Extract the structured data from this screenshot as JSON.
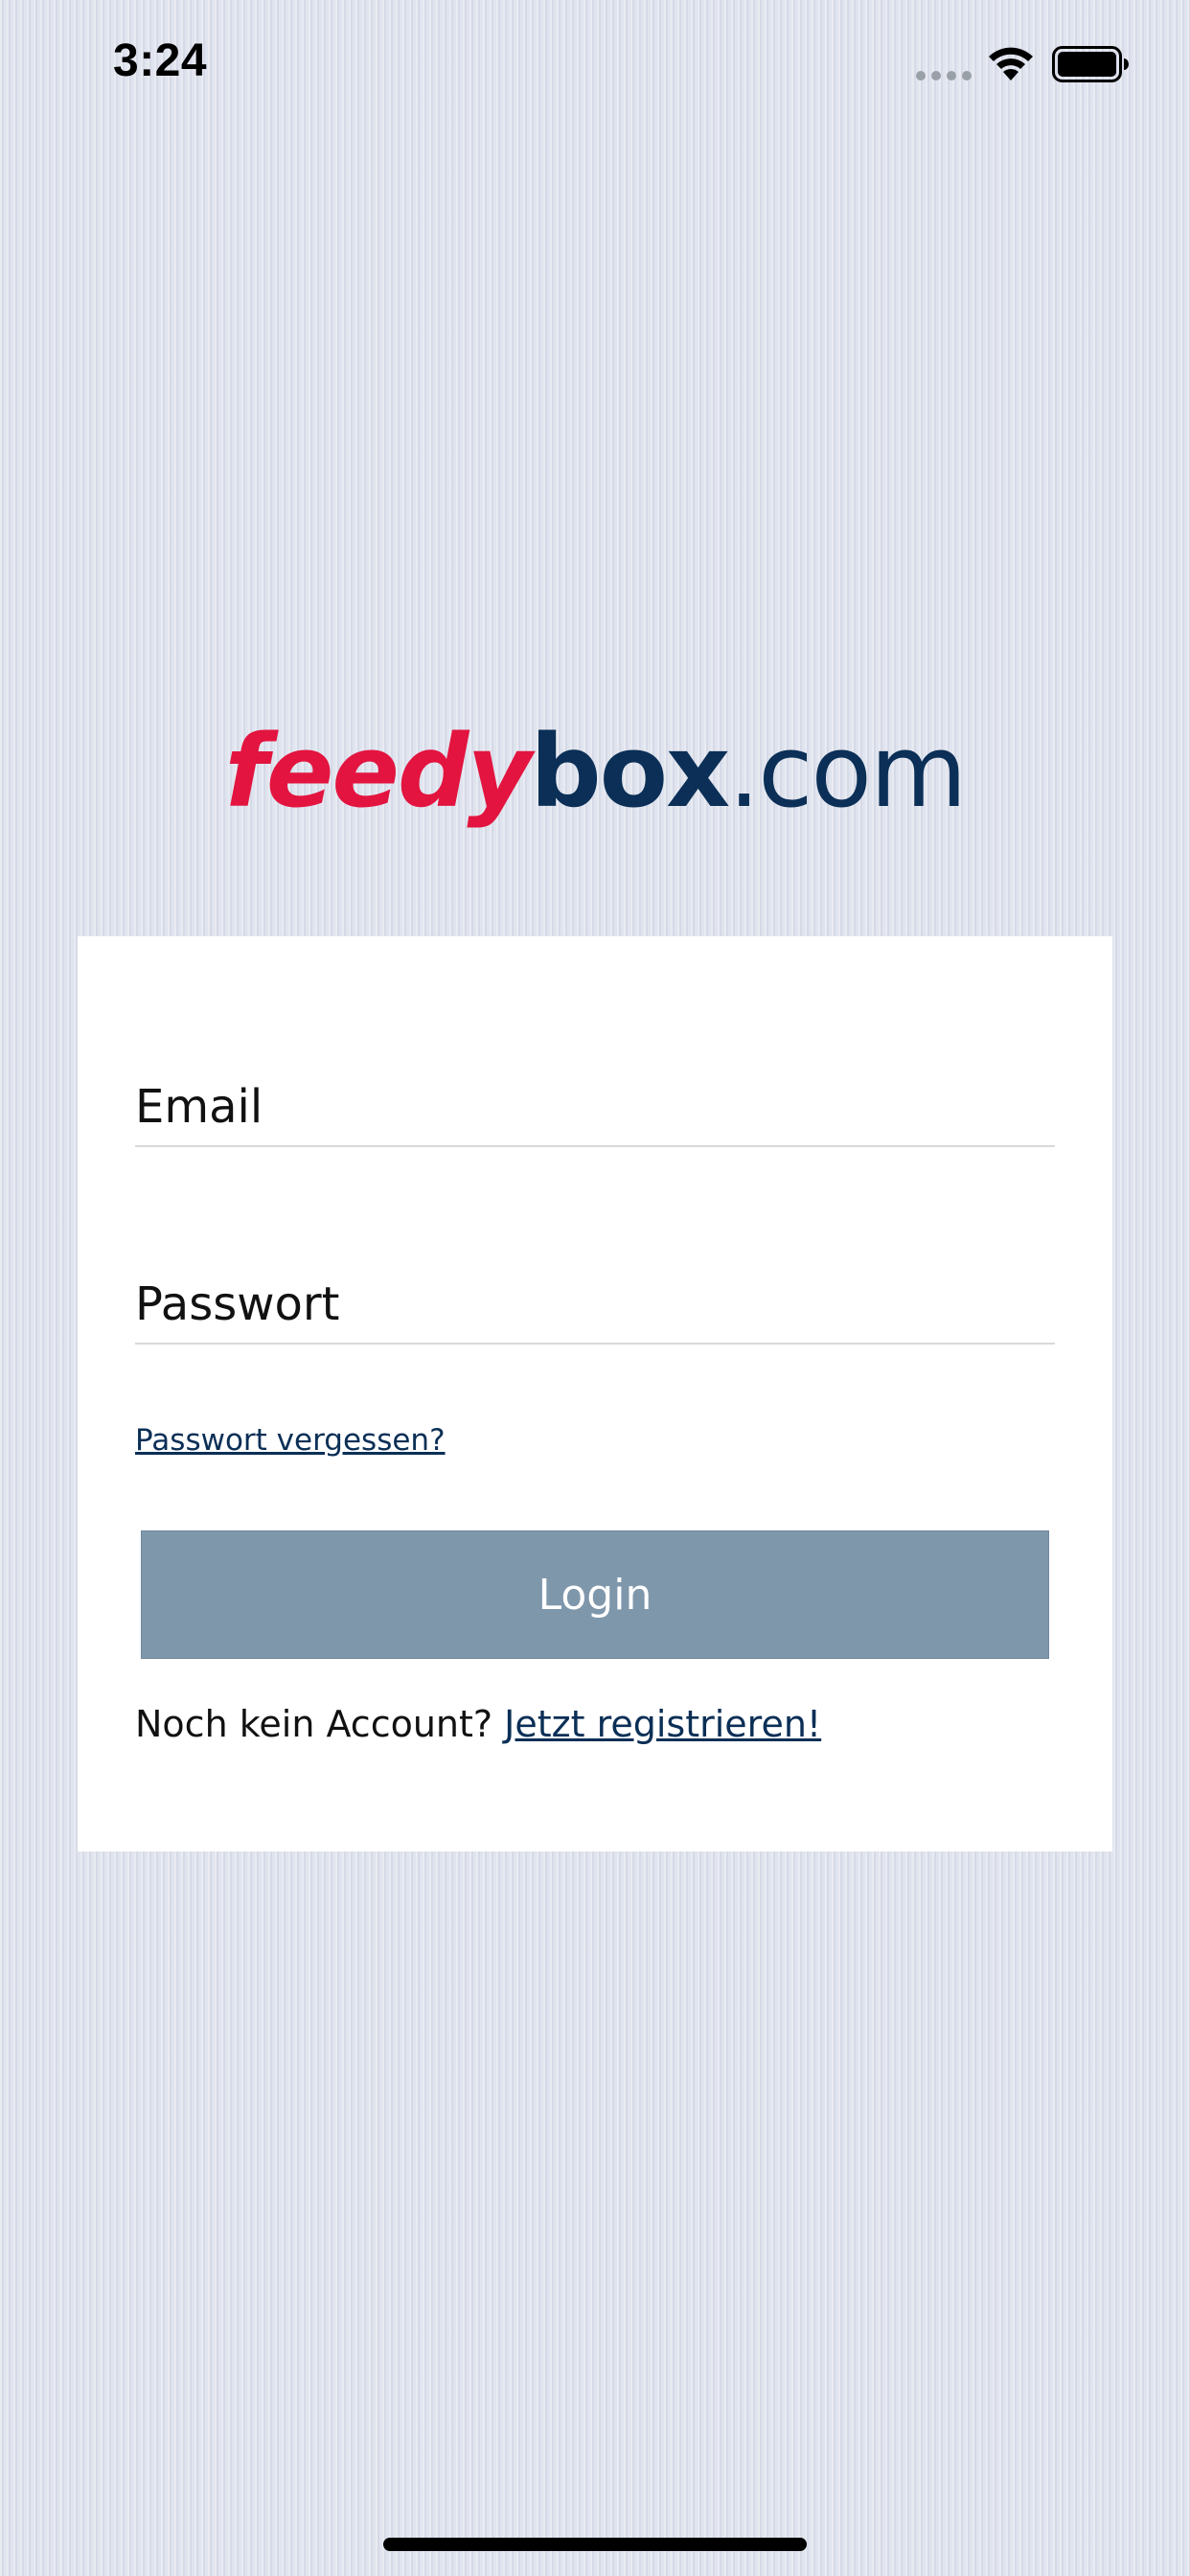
{
  "status_bar": {
    "time": "3:24"
  },
  "logo": {
    "part1": "feedy",
    "part2": "box",
    "part3": ".com",
    "colors": {
      "part1": "#e3143f",
      "part2": "#0b2f56",
      "part3": "#0b2f56"
    }
  },
  "login_form": {
    "email_placeholder": "Email",
    "email_value": "",
    "password_placeholder": "Passwort",
    "password_value": "",
    "forgot_password": "Passwort vergessen?",
    "login_label": "Login",
    "no_account_text": "Noch kein Account? ",
    "register_link": "Jetzt registrieren!"
  },
  "theme": {
    "accent": "#0b2f56",
    "button_bg": "#7f97ab",
    "background": "#dde1ec"
  },
  "icons": {
    "signal": "cellular-signal-icon",
    "wifi": "wifi-icon",
    "battery": "battery-icon"
  }
}
